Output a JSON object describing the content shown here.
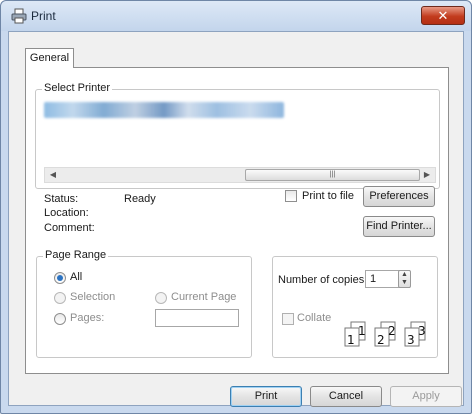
{
  "window": {
    "title": "Print",
    "close_glyph": "✕"
  },
  "tabs": [
    {
      "label": "General"
    }
  ],
  "select_printer": {
    "legend": "Select Printer",
    "scroll_thumb_glyph": "|||"
  },
  "status": {
    "status_label": "Status:",
    "status_value": "Ready",
    "location_label": "Location:",
    "comment_label": "Comment:",
    "print_to_file_label": "Print to file",
    "print_to_file_checked": false,
    "preferences_label": "Preferences",
    "find_printer_label": "Find Printer..."
  },
  "page_range": {
    "legend": "Page Range",
    "options": {
      "all": "All",
      "selection": "Selection",
      "current_page": "Current Page",
      "pages": "Pages:"
    },
    "selected": "all",
    "pages_value": ""
  },
  "copies": {
    "label": "Number of copies:",
    "value": "1",
    "collate_label": "Collate",
    "collate_checked": false,
    "collate_pages": [
      "1",
      "1",
      "2",
      "2",
      "3",
      "3"
    ]
  },
  "buttons": {
    "print": "Print",
    "cancel": "Cancel",
    "apply": "Apply"
  },
  "colors": {
    "accent": "#2b73c2",
    "close": "#c23c1e",
    "frame": "#c9d9ee"
  },
  "icons": {
    "title": "printer-icon",
    "close": "close-icon"
  }
}
